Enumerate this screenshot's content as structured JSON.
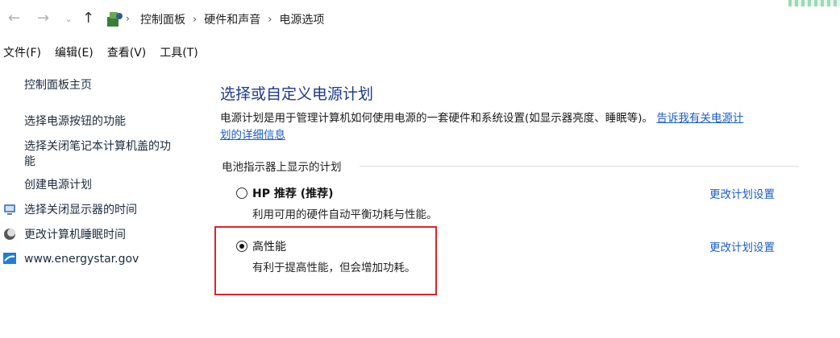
{
  "breadcrumb": [
    "控制面板",
    "硬件和声音",
    "电源选项"
  ],
  "menu": [
    "文件(F)",
    "编辑(E)",
    "查看(V)",
    "工具(T)"
  ],
  "sidebar": {
    "home": "控制面板主页",
    "links": [
      {
        "label": "选择电源按钮的功能"
      },
      {
        "label_line1": "选择关闭笔记本计算机盖的功",
        "label_line2": "能"
      },
      {
        "label": "创建电源计划"
      },
      {
        "label": "选择关闭显示器的时间",
        "icon": "display-icon"
      },
      {
        "label": "更改计算机睡眠时间",
        "icon": "sleep-icon"
      },
      {
        "label": "www.energystar.gov",
        "icon": "energystar-icon"
      }
    ]
  },
  "main": {
    "title": "选择或自定义电源计划",
    "description": "电源计划是用于管理计算机如何使用电源的一套硬件和系统设置(如显示器亮度、睡眠等)。",
    "link_line1": "告诉我有关电源计",
    "link_line2": "划的详细信息",
    "group_label": "电池指示器上显示的计划",
    "plans": [
      {
        "name": "HP 推荐 (推荐)",
        "description": "利用可用的硬件自动平衡功耗与性能。",
        "selected": false,
        "change_label": "更改计划设置"
      },
      {
        "name": "高性能",
        "description": "有利于提高性能，但会增加功耗。",
        "selected": true,
        "change_label": "更改计划设置"
      }
    ]
  },
  "colors": {
    "title": "#1e3a8a",
    "link": "#1a5dc8",
    "highlight_border": "#d9262a"
  }
}
